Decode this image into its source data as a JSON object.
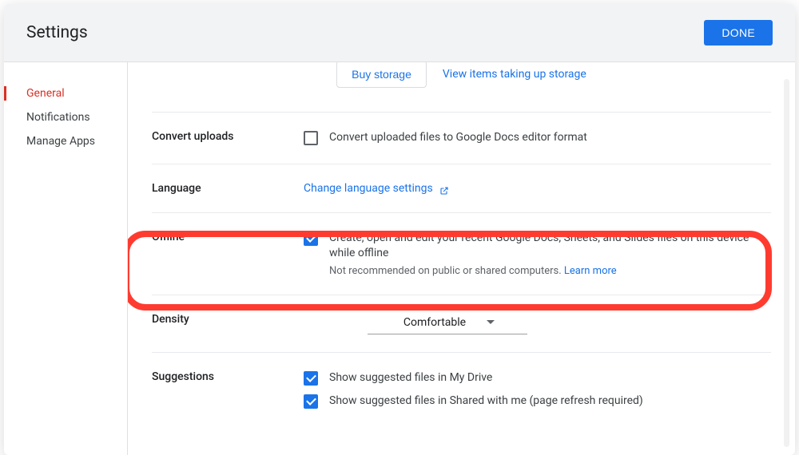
{
  "header": {
    "title": "Settings",
    "done_label": "DONE"
  },
  "sidebar": {
    "items": [
      {
        "label": "General",
        "active": true
      },
      {
        "label": "Notifications",
        "active": false
      },
      {
        "label": "Manage Apps",
        "active": false
      }
    ]
  },
  "storage": {
    "buy_label": "Buy storage",
    "view_label": "View items taking up storage"
  },
  "convert": {
    "section_label": "Convert uploads",
    "checkbox_label": "Convert uploaded files to Google Docs editor format",
    "checked": false
  },
  "language": {
    "section_label": "Language",
    "link_label": "Change language settings"
  },
  "offline": {
    "section_label": "Offline",
    "checkbox_label": "Create, open and edit your recent Google Docs, Sheets, and Slides files on this device while offline",
    "subtext": "Not recommended on public or shared computers.",
    "learn_more": "Learn more",
    "checked": true
  },
  "density": {
    "section_label": "Density",
    "value": "Comfortable"
  },
  "suggestions": {
    "section_label": "Suggestions",
    "opt1": {
      "label": "Show suggested files in My Drive",
      "checked": true
    },
    "opt2": {
      "label": "Show suggested files in Shared with me (page refresh required)",
      "checked": true
    }
  }
}
